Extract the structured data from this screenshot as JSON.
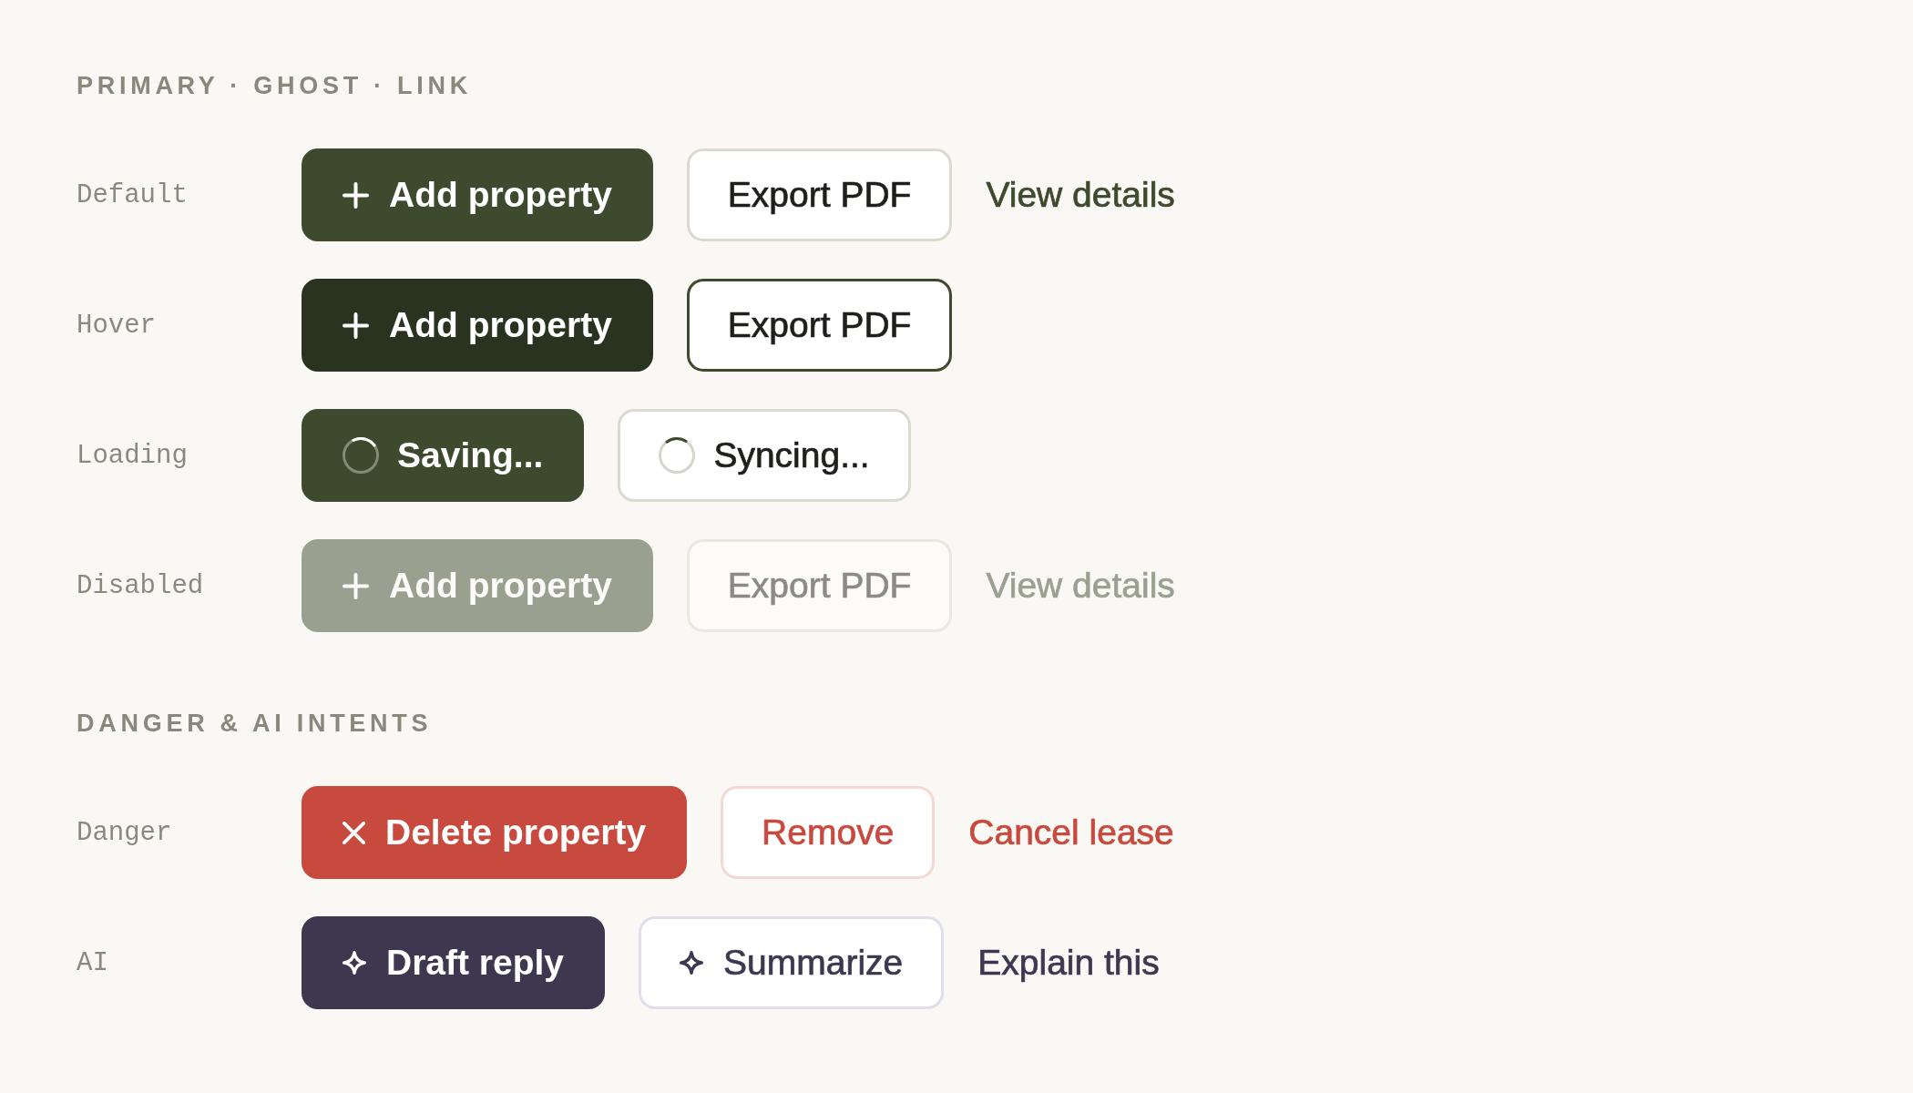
{
  "sections": [
    {
      "title": "PRIMARY · GHOST · LINK",
      "rows": [
        {
          "label": "Default",
          "kind": "neutral",
          "hover": false,
          "loading": false,
          "disabled": false,
          "buttons": [
            {
              "kind": "primary",
              "text": "Add property",
              "icon": true
            },
            {
              "kind": "ghost",
              "text": "Export PDF",
              "icon": false
            },
            {
              "kind": "link",
              "text": "View details",
              "icon": false
            }
          ]
        },
        {
          "label": "Hover",
          "kind": "neutral",
          "hover": true,
          "loading": false,
          "disabled": false,
          "buttons": [
            {
              "kind": "primary",
              "text": "Add property",
              "icon": true
            },
            {
              "kind": "ghost",
              "text": "Export PDF",
              "icon": false
            }
          ]
        },
        {
          "label": "Loading",
          "kind": "neutral",
          "hover": false,
          "loading": true,
          "disabled": false,
          "buttons": [
            {
              "kind": "primary",
              "text": "Saving...",
              "icon": true
            },
            {
              "kind": "ghost",
              "text": "Syncing...",
              "icon": true
            }
          ]
        },
        {
          "label": "Disabled",
          "kind": "neutral",
          "hover": false,
          "loading": false,
          "disabled": true,
          "buttons": [
            {
              "kind": "primary",
              "text": "Add property",
              "icon": true
            },
            {
              "kind": "ghost",
              "text": "Export PDF",
              "icon": false
            },
            {
              "kind": "link",
              "text": "View details",
              "icon": false
            }
          ]
        }
      ]
    },
    {
      "title": "DANGER & AI INTENTS",
      "rows": [
        {
          "label": "Danger",
          "kind": "danger",
          "hover": false,
          "loading": false,
          "disabled": false,
          "buttons": [
            {
              "kind": "primary",
              "text": "Delete property",
              "icon": true
            },
            {
              "kind": "ghost",
              "text": "Remove",
              "icon": false
            },
            {
              "kind": "link",
              "text": "Cancel lease",
              "icon": false
            }
          ]
        },
        {
          "label": "AI",
          "kind": "ai",
          "hover": false,
          "loading": false,
          "disabled": false,
          "buttons": [
            {
              "kind": "primary",
              "text": "Draft reply",
              "icon": true
            },
            {
              "kind": "ghost",
              "text": "Summarize",
              "icon": true
            },
            {
              "kind": "link",
              "text": "Explain this",
              "icon": false
            }
          ]
        }
      ]
    }
  ]
}
